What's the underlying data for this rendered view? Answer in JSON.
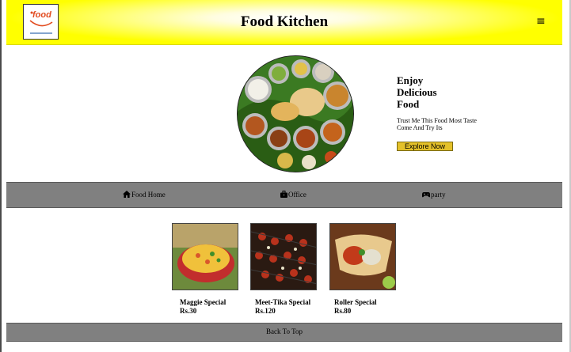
{
  "header": {
    "logo_text": "food",
    "title": "Food Kitchen",
    "menu_icon": "hamburger-menu-icon"
  },
  "hero": {
    "heading": [
      "Enjoy",
      "Delicious",
      "Food"
    ],
    "subtext": "Trust Me This Food Most Taste Come And Try Its",
    "button_label": "Explore Now",
    "button_color": "#e4c12a"
  },
  "nav": {
    "items": [
      {
        "icon": "home-icon",
        "label": "Food Home"
      },
      {
        "icon": "briefcase-icon",
        "label": "Office"
      },
      {
        "icon": "gamepad-icon",
        "label": "party"
      }
    ]
  },
  "menu": {
    "cards": [
      {
        "name": "Maggie Special",
        "price": "Rs.30"
      },
      {
        "name": "Meet-Tika Special",
        "price": "Rs.120"
      },
      {
        "name": "Roller Special",
        "price": "Rs.80"
      }
    ]
  },
  "footer": {
    "back_to_top": "Back To Top"
  },
  "colors": {
    "header_bg": "#ffff00",
    "bar_bg": "#808080"
  }
}
